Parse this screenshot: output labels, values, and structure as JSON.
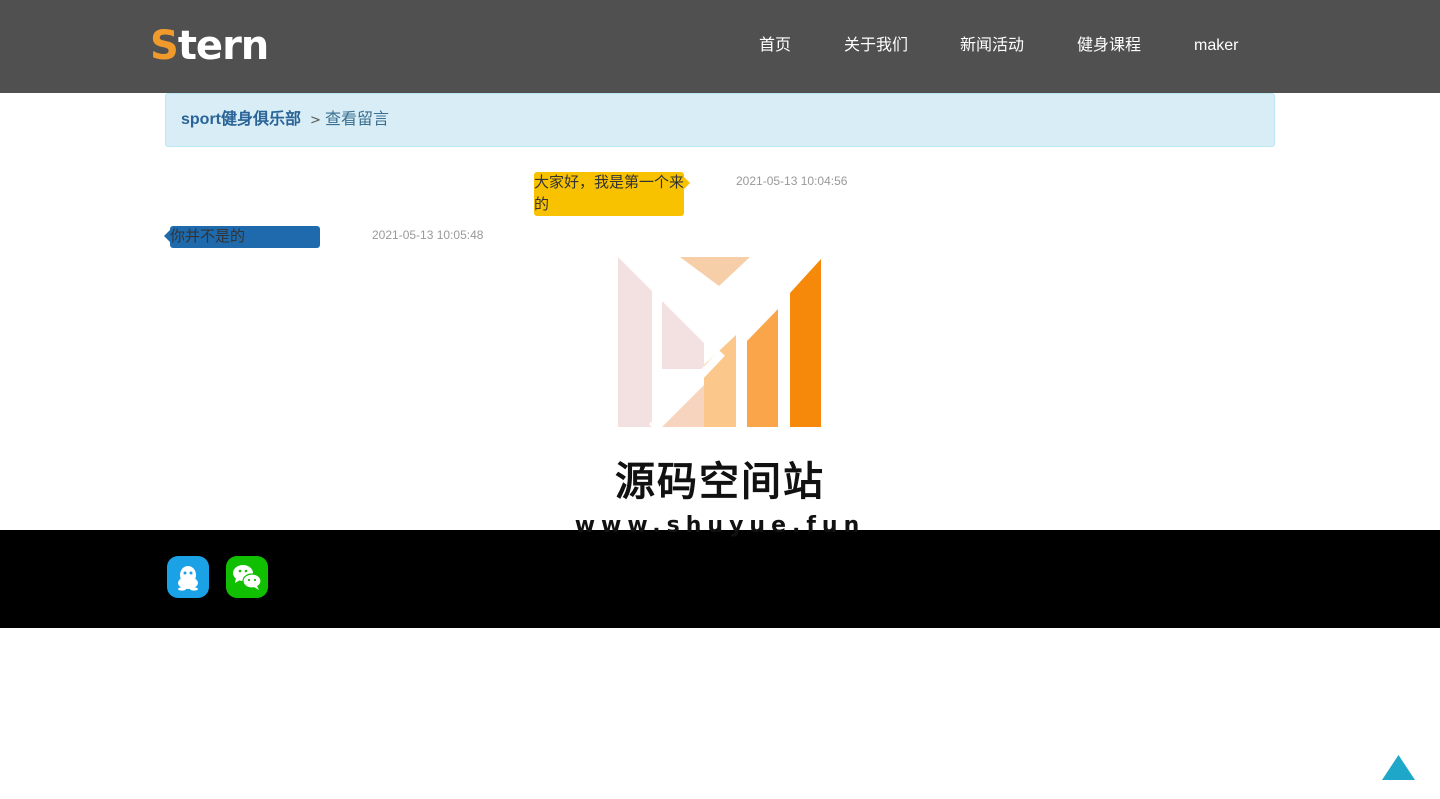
{
  "header": {
    "logo_first": "S",
    "logo_rest": "tern",
    "nav": [
      "首页",
      "关于我们",
      "新闻活动",
      "健身课程",
      "maker"
    ]
  },
  "breadcrumb": {
    "home": "sport健身俱乐部",
    "separator": ">",
    "current": "查看留言"
  },
  "messages": [
    {
      "side": "right",
      "text": "大家好，我是第一个来的",
      "time": "2021-05-13 10:04:56"
    },
    {
      "side": "left",
      "text": "你并不是的",
      "time": "2021-05-13 10:05:48"
    }
  ],
  "watermark": {
    "title": "源码空间站",
    "url": "www.shuyue.fun"
  },
  "footer": {
    "icons": [
      "qq-icon",
      "wechat-icon"
    ]
  },
  "colors": {
    "header_bg": "#505050",
    "logo_accent": "#f09a2c",
    "breadcrumb_bg": "#d9edf7",
    "bubble_right": "#f9c200",
    "bubble_left": "#1e6aad",
    "footer_bg": "#000000",
    "qq": "#1aa1e6",
    "wechat": "#10c000",
    "back_to_top": "#1ea7c8"
  }
}
